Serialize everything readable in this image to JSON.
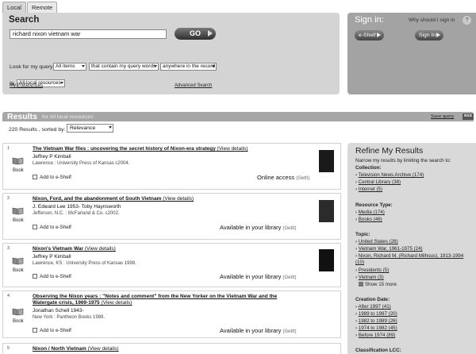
{
  "tabs": [
    "Local",
    "Remote"
  ],
  "search": {
    "title": "Search",
    "query": "richard nixon vietnam war",
    "go_label": "GO",
    "look_label": "Look for my query :",
    "field_select": "All items",
    "match_select": "that contain my query words",
    "scope_select": "anywhere in the record",
    "in_label": "In",
    "resource_select": "All local resources",
    "preferences_link": "My Preferences",
    "advanced_link": "Advanced Search"
  },
  "signin": {
    "title": "Sign in:",
    "why_link": "Why should I sign in",
    "help": "?",
    "eshelf_label": "e-Shelf",
    "signin_label": "Sign In"
  },
  "results_header": {
    "title": "Results",
    "subtitle": "for  All local resources",
    "save_query": "Save query",
    "rss": "RSS",
    "count": "220",
    "count_text": "Results , sorted by:",
    "sort_value": "Relevance"
  },
  "results": [
    {
      "num": "1",
      "type": "Book",
      "title": "The Vietnam War files : uncovering the secret history of Nixon-era strategy",
      "details": "(View details)",
      "author": "Jeffrey P Kimball",
      "pub": "Lawrence : University Press of Kansas c2004.",
      "add": "Add to e-Shelf",
      "availability": "Online access",
      "getit": "(GetIt)"
    },
    {
      "num": "2",
      "type": "Book",
      "title": "Nixon, Ford, and the abandonment of South Vietnam",
      "details": "(View details)",
      "author": "J. Edward Lee 1953- Toby Haynsworth",
      "pub": "Jefferson, N.C. : McFarland & Co. c2002.",
      "add": "Add to e-Shelf",
      "availability": "Available in your library",
      "getit": "(GetIt)"
    },
    {
      "num": "3",
      "type": "Book",
      "title": "Nixon's Vietnam War",
      "details": "(View details)",
      "author": "Jeffrey P Kimball",
      "pub": "Lawrence, KS : University Press of Kansas 1998.",
      "add": "Add to e-Shelf",
      "availability": "Available in your library",
      "getit": "(GetIt)"
    },
    {
      "num": "4",
      "type": "Book",
      "title": "Observing the Nixon years : \"Notes and comment\" from the New Yorker on the Vietnam War and the Watergate crisis, 1969-1975",
      "details": "(View details)",
      "author": "Jonathan Schell 1943-",
      "pub": "New York : Pantheon Books 1989.",
      "add": "Add to e-Shelf",
      "availability": "Available in your library",
      "getit": "(GetIt)"
    },
    {
      "num": "5",
      "type": "Book",
      "title": "Nixon / North Vietnam",
      "details": "(View details)",
      "author": "",
      "pub": "",
      "add": "",
      "availability": "",
      "getit": ""
    }
  ],
  "refine": {
    "title": "Refine My Results",
    "intro": "Narrow my results by limiting the search to:",
    "collection_h": "Collection:",
    "collection": [
      "Television News Archive (174)",
      "Central Library (38)",
      "Internet (5)"
    ],
    "resource_h": "Resource Type:",
    "resource": [
      "Media (174)",
      "Books (46)"
    ],
    "topic_h": "Topic:",
    "topic": [
      "United States (28)",
      "Vietnam War, 1961-1975 (24)",
      "Nixon, Richard M. (Richard Milhous), 1913-1994 (10)",
      "Presidents (5)",
      "Vietnam (3)"
    ],
    "show_more": "Show 15 more",
    "date_h": "Creation Date:",
    "date": [
      "After 1997 (41)",
      "1989 to 1997 (20)",
      "1982 to 1989 (26)",
      "1974 to 1982 (45)",
      "Before 1974 (89)"
    ],
    "lcc_h": "Classification LCC:"
  }
}
